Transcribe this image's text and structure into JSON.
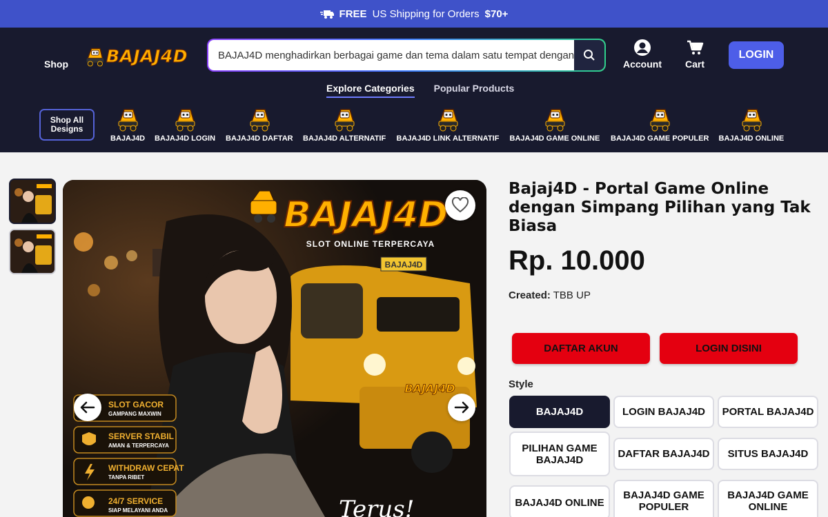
{
  "promo": {
    "free": "FREE",
    "text": "US Shipping for Orders",
    "amount": "$70+"
  },
  "header": {
    "shop": "Shop",
    "logo_text": "BAJAJ4D",
    "search_value": "BAJAJ4D menghadirkan berbagai game dan tema dalam satu tempat dengan",
    "account": "Account",
    "cart": "Cart",
    "login": "LOGIN",
    "tabs": [
      "Explore Categories",
      "Popular Products"
    ],
    "shop_all": "Shop All Designs",
    "categories": [
      "BAJAJ4D",
      "BAJAJ4D LOGIN",
      "BAJAJ4D DAFTAR",
      "BAJAJ4D ALTERNATIF",
      "BAJAJ4D LINK ALTERNATIF",
      "BAJAJ4D GAME ONLINE",
      "BAJAJ4D GAME POPULER",
      "BAJAJ4D ONLINE"
    ]
  },
  "hero": {
    "brand": "BAJAJ4D",
    "tagline": "SLOT ONLINE TERPERCAYA",
    "plate": "BAJAJ4D",
    "features": [
      {
        "title": "SLOT GACOR",
        "sub": "GAMPANG MAXWIN"
      },
      {
        "title": "SERVER STABIL",
        "sub": "AMAN & TERPERCAYA"
      },
      {
        "title": "WITHDRAW CEPAT",
        "sub": "TANPA RIBET"
      },
      {
        "title": "24/7 SERVICE",
        "sub": "SIAP MELAYANI ANDA"
      }
    ],
    "script": "Terus!"
  },
  "product": {
    "title": "Bajaj4D - Portal Game Online dengan Simpang Pilihan yang Tak Biasa",
    "price": "Rp. 10.000",
    "created_label": "Created:",
    "created_value": "TBB UP",
    "cta_daftar": "DAFTAR AKUN",
    "cta_login": "LOGIN DISINI",
    "style_label": "Style",
    "styles": [
      "BAJAJ4D",
      "LOGIN BAJAJ4D",
      "PORTAL BAJAJ4D",
      "PILIHAN GAME BAJAJ4D",
      "DAFTAR BAJAJ4D",
      "SITUS BAJAJ4D",
      "BAJAJ4D ONLINE",
      "BAJAJ4D GAME POPULER",
      "BAJAJ4D GAME ONLINE"
    ]
  },
  "colors": {
    "promo": "#3f52c9",
    "header": "#181a2e",
    "accent": "#4d5ee8",
    "cta": "#e40010"
  }
}
